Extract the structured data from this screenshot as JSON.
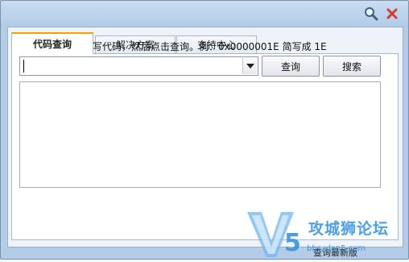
{
  "titlebar": {
    "search_icon": "search-icon",
    "close_icon": "close-icon"
  },
  "tabs": [
    {
      "label": "代码查询",
      "active": true
    },
    {
      "label": "解决方案",
      "active": false
    },
    {
      "label": "支持中心",
      "active": false
    }
  ],
  "main": {
    "instruction": "在下面输入蓝屏简写代码，然后点击查询。例：0x0000001E 简写成 1E",
    "input_value": "",
    "query_button": "查询",
    "search_button": "搜索",
    "result_text": ""
  },
  "status": {
    "text": "查询最新版"
  },
  "watermark": {
    "title": "攻城狮论坛",
    "url": "bbs.vlan5.com"
  },
  "colors": {
    "frame": "#b3cde9",
    "accent": "#f0a000",
    "close": "#d23c2a",
    "watermark": "#4a9fe8"
  }
}
